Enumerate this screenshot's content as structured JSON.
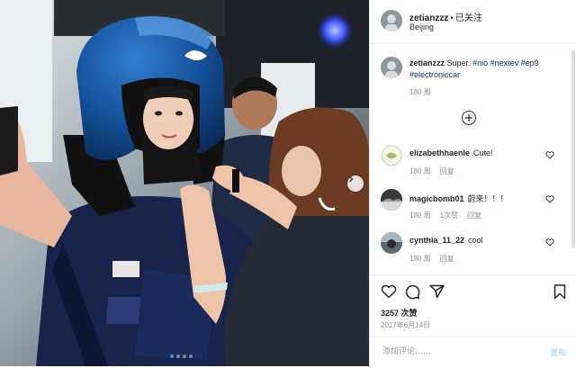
{
  "post": {
    "username": "zetianzzz",
    "separator": "•",
    "follow_label": "已关注",
    "location": "Beijing",
    "caption": {
      "username": "zetianzzz",
      "text": "Super.",
      "hashtags": [
        "#nio",
        "#nextev",
        "#ep9",
        "#electroniccar"
      ],
      "age": "180 周"
    },
    "load_more_icon": "plus-circle-icon",
    "comments": [
      {
        "username": "elizabethhaenle",
        "text": "Cute!",
        "age": "180 周",
        "likes": "",
        "reply_label": "回复"
      },
      {
        "username": "magicbomb01",
        "text": "蔚来！！！",
        "age": "180 周",
        "likes": "1次赞",
        "reply_label": "回复"
      },
      {
        "username": "cynthia_11_22",
        "text": "cool",
        "age": "180 周",
        "likes": "",
        "reply_label": "回复"
      }
    ],
    "likes_count": "3257 次赞",
    "date": "2017年6月14日",
    "comment_placeholder": "添加评论……",
    "post_button": "发布"
  },
  "carousel": {
    "total": 4,
    "active": 1
  },
  "colors": {
    "link": "#003569",
    "accent": "#3897f0",
    "muted": "#8e8e8e"
  }
}
